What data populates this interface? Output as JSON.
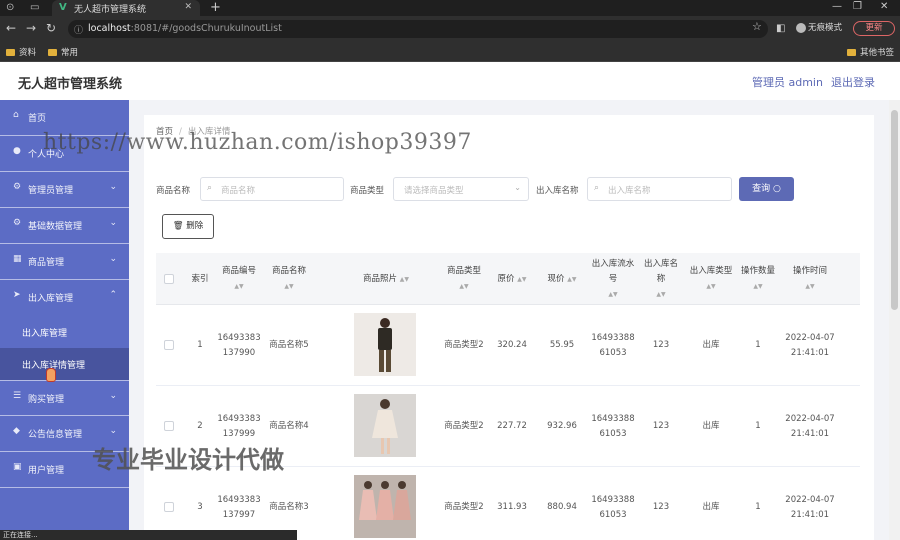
{
  "browser": {
    "tab_title": "无人超市管理系统",
    "tab_close": "✕",
    "new_tab": "+",
    "url_host": "localhost",
    "url_rest": ":8081/#/goodsChurukuInoutList",
    "incognito_label": "无痕模式",
    "update_label": "更新",
    "bookmarks": [
      "资料",
      "常用"
    ],
    "bookmarks_right": "其他书签",
    "status_text": "正在连接..."
  },
  "header": {
    "title": "无人超市管理系统",
    "admin": "管理员 admin",
    "logout": "退出登录"
  },
  "sidebar": {
    "items": [
      {
        "label": "首页",
        "icon": "home-icon",
        "glyph": "⌂"
      },
      {
        "label": "个人中心",
        "icon": "user-icon",
        "glyph": "●"
      },
      {
        "label": "管理员管理",
        "icon": "settings-icon",
        "glyph": "⚙",
        "chevron": "⌄"
      },
      {
        "label": "基础数据管理",
        "icon": "gear-icon",
        "glyph": "⚙",
        "chevron": "⌄"
      },
      {
        "label": "商品管理",
        "icon": "box-icon",
        "glyph": "▦",
        "chevron": "⌄"
      },
      {
        "label": "出入库管理",
        "icon": "send-icon",
        "glyph": "➤",
        "chevron": "⌃"
      }
    ],
    "subitems": [
      "出入库管理",
      "出入库详情管理"
    ],
    "items2": [
      {
        "label": "购买管理",
        "icon": "list-icon",
        "glyph": "☰",
        "chevron": "⌄"
      },
      {
        "label": "公告信息管理",
        "icon": "bell-icon",
        "glyph": "◆",
        "chevron": "⌄"
      },
      {
        "label": "用户管理",
        "icon": "users-icon",
        "glyph": "▣"
      }
    ]
  },
  "breadcrumb": [
    "首页",
    "出入库详情"
  ],
  "filters": {
    "name_label": "商品名称",
    "name_placeholder": "商品名称",
    "type_label": "商品类型",
    "type_placeholder": "请选择商品类型",
    "inout_label": "出入库名称",
    "inout_placeholder": "出入库名称",
    "query_label": "查询",
    "delete_label": "删除"
  },
  "table": {
    "headers": {
      "index": "索引",
      "code": "商品编号",
      "name": "商品名称",
      "photo": "商品照片",
      "type": "商品类型",
      "orig": "原价",
      "now": "现价",
      "serial": "出入库流水号",
      "inout_name": "出入库名称",
      "inout_type": "出入库类型",
      "qty": "操作数量",
      "time": "操作时间"
    },
    "rows": [
      {
        "index": "1",
        "code": "16493383137990",
        "name": "商品名称5",
        "type": "商品类型2",
        "orig": "320.24",
        "now": "55.95",
        "serial": "1649338861053",
        "inout_name": "123",
        "inout_type": "出库",
        "qty": "1",
        "time": "2022-04-07 21:41:01"
      },
      {
        "index": "2",
        "code": "16493383137999",
        "name": "商品名称4",
        "type": "商品类型2",
        "orig": "227.72",
        "now": "932.96",
        "serial": "1649338861053",
        "inout_name": "123",
        "inout_type": "出库",
        "qty": "1",
        "time": "2022-04-07 21:41:01"
      },
      {
        "index": "3",
        "code": "16493383137997",
        "name": "商品名称3",
        "type": "商品类型2",
        "orig": "311.93",
        "now": "880.94",
        "serial": "1649338861053",
        "inout_name": "123",
        "inout_type": "出库",
        "qty": "1",
        "time": "2022-04-07 21:41:01"
      }
    ]
  },
  "watermark": "https://www.huzhan.com/ishop39397",
  "watermark2": "专业毕业设计代做"
}
